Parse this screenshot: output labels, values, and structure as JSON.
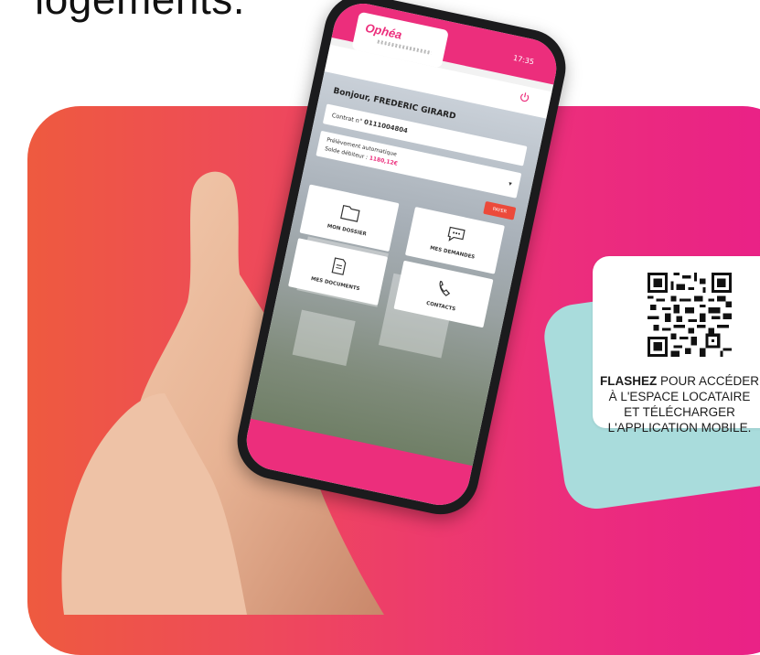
{
  "heading": {
    "text": "logements."
  },
  "qr": {
    "caption_bold": "FLASHEZ",
    "caption_line1_rest": " POUR ACCÉDER",
    "caption_line2": "À L'ESPACE LOCATAIRE",
    "caption_line3": "ET TÉLÉCHARGER",
    "caption_line4": "L'APPLICATION MOBILE."
  },
  "phone": {
    "status_time": "17:35",
    "logo": "Ophéa",
    "greeting": "Bonjour, FREDERIC GIRARD",
    "contract_label": "Contrat n°",
    "contract_number": "0111004804",
    "payment_label": "Prélèvement automatique",
    "balance_label": "Solde débiteur :",
    "balance_value": "1180,12€",
    "pay_button": "PAYER",
    "tiles": [
      {
        "label": "MON DOSSIER",
        "icon": "folder-icon"
      },
      {
        "label": "MES DEMANDES",
        "icon": "chat-icon"
      },
      {
        "label": "MES DOCUMENTS",
        "icon": "document-icon"
      },
      {
        "label": "CONTACTS",
        "icon": "phone-icon"
      }
    ]
  },
  "colors": {
    "brand_pink": "#ec2e7c",
    "brand_orange": "#ee5a3f",
    "teal": "#a9dcdc"
  }
}
